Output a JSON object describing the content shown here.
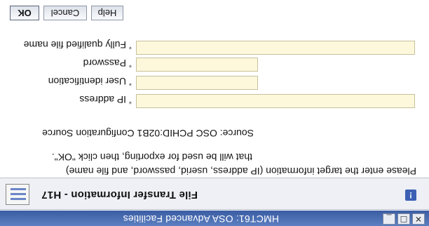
{
  "window": {
    "title": "HMCT61: OSA Advanced Facilities",
    "controls": [
      "minimize-icon",
      "maximize-icon",
      "close-icon"
    ]
  },
  "header": {
    "title": "File Transfer Information - H17",
    "help_icon": "info-icon",
    "app_icon": "app-window-icon"
  },
  "instructions": {
    "line1": "Please enter the target information (IP address, userid, password, and file name)",
    "line2": "that will be used for exporting, then click \"OK\".",
    "source": "Source: OSC PCHID:02B1 Configuration Source"
  },
  "form": {
    "required_marker": "*",
    "ip_address": {
      "label": "IP address",
      "value": ""
    },
    "user_id": {
      "label": "User identification",
      "value": ""
    },
    "password": {
      "label": "Password",
      "value": ""
    },
    "file_name": {
      "label": "Fully qualified file name",
      "value": ""
    }
  },
  "buttons": {
    "ok": "OK",
    "cancel": "Cancel",
    "help": "Help"
  },
  "colors": {
    "titlebar": "#3b5da3",
    "field_bg": "#fdf8dc"
  }
}
